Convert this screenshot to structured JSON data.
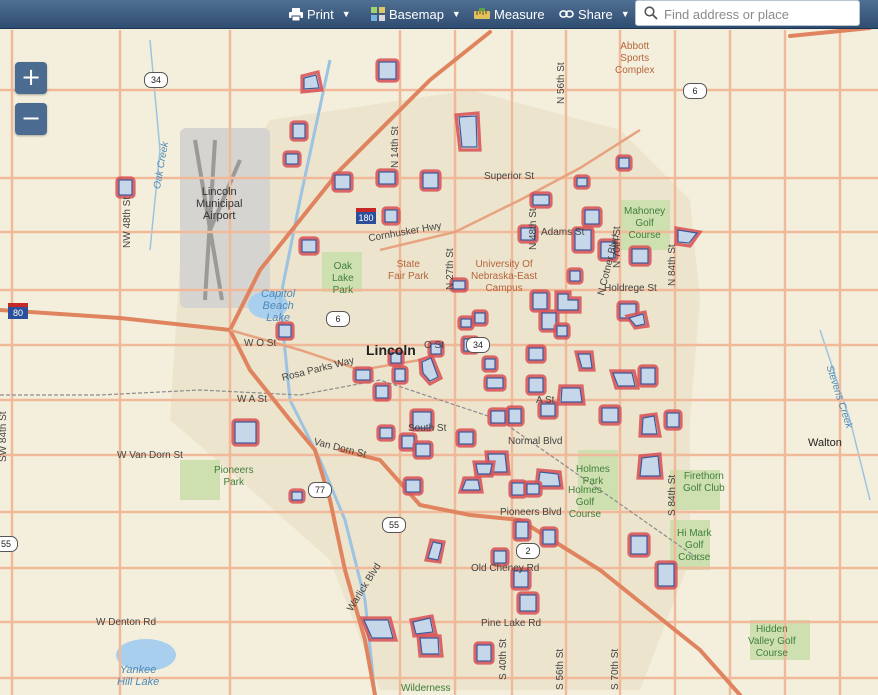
{
  "toolbar": {
    "print_label": "Print",
    "basemap_label": "Basemap",
    "measure_label": "Measure",
    "share_label": "Share",
    "search_placeholder": "Find address or place"
  },
  "zoom": {
    "in_label": "+",
    "out_label": "−"
  },
  "map": {
    "city": "Lincoln",
    "town_walton": "Walton",
    "airport": [
      "Lincoln",
      "Municipal",
      "Airport"
    ],
    "streets": {
      "superior": "Superior St",
      "cornhusker": "Cornhusker Hwy",
      "holdrege": "Holdrege St",
      "adams": "Adams St",
      "wo": "W O St",
      "rosa": "Rosa Parks Way",
      "wa": "W A St",
      "van_dorn_w": "W Van Dorn St",
      "van_dorn": "Van Dorn St",
      "south": "South St",
      "a": "A St",
      "normal": "Normal Blvd",
      "pioneers": "Pioneers Blvd",
      "old_cheney": "Old Cheney Rd",
      "pine_lake": "Pine Lake Rd",
      "denton": "W Denton Rd",
      "warlick": "Warlick Blvd",
      "o": "O St",
      "nw48": "NW 48th St",
      "sw84": "SW 84th St",
      "n14": "N 14th St",
      "n27": "N 27th St",
      "n48": "N 48th St",
      "n56": "N 56th St",
      "n70": "N 70th St",
      "n84": "N 84th St",
      "s84": "S 84th St",
      "s40": "S 40th St",
      "s56": "S 56th St",
      "s70": "S 70th St",
      "cotner": "N Cotner Blvd"
    },
    "features": {
      "abbott": [
        "Abbott",
        "Sports",
        "Complex"
      ],
      "mahoney": [
        "Mahoney",
        "Golf",
        "Course"
      ],
      "unl": [
        "University Of",
        "Nebraska-East",
        "Campus"
      ],
      "state_fair": [
        "State",
        "Fair Park"
      ],
      "oak_lake": [
        "Oak",
        "Lake",
        "Park"
      ],
      "capitol": [
        "Capitol",
        "Beach",
        "Lake"
      ],
      "pioneers_park": [
        "Pioneers",
        "Park"
      ],
      "holmes_park": [
        "Holmes",
        "Park"
      ],
      "holmes_golf": [
        "Holmes",
        "Golf",
        "Course"
      ],
      "firethorn": [
        "Firethorn",
        "Golf Club"
      ],
      "hi_mark": [
        "Hi Mark",
        "Golf",
        "Course"
      ],
      "hidden_valley": [
        "Hidden",
        "Valley Golf",
        "Course"
      ],
      "yankee": [
        "Yankee",
        "Hill Lake"
      ],
      "wilderness": "Wilderness",
      "oak_creek": "Oak Creek",
      "stevens_creek": "Stevens Creek"
    },
    "shields": {
      "us34": "34",
      "us6_e": "6",
      "i180": "180",
      "i80": "80",
      "us6": "6",
      "us34_c": "34",
      "us77": "77",
      "s55": "55",
      "s2": "2",
      "s55w": "55"
    }
  },
  "colors": {
    "toolbar": "#3e5e84",
    "parcel_outline": "#d9555a",
    "parcel_fill": "#c7d7ea",
    "road": "#e0845f"
  }
}
